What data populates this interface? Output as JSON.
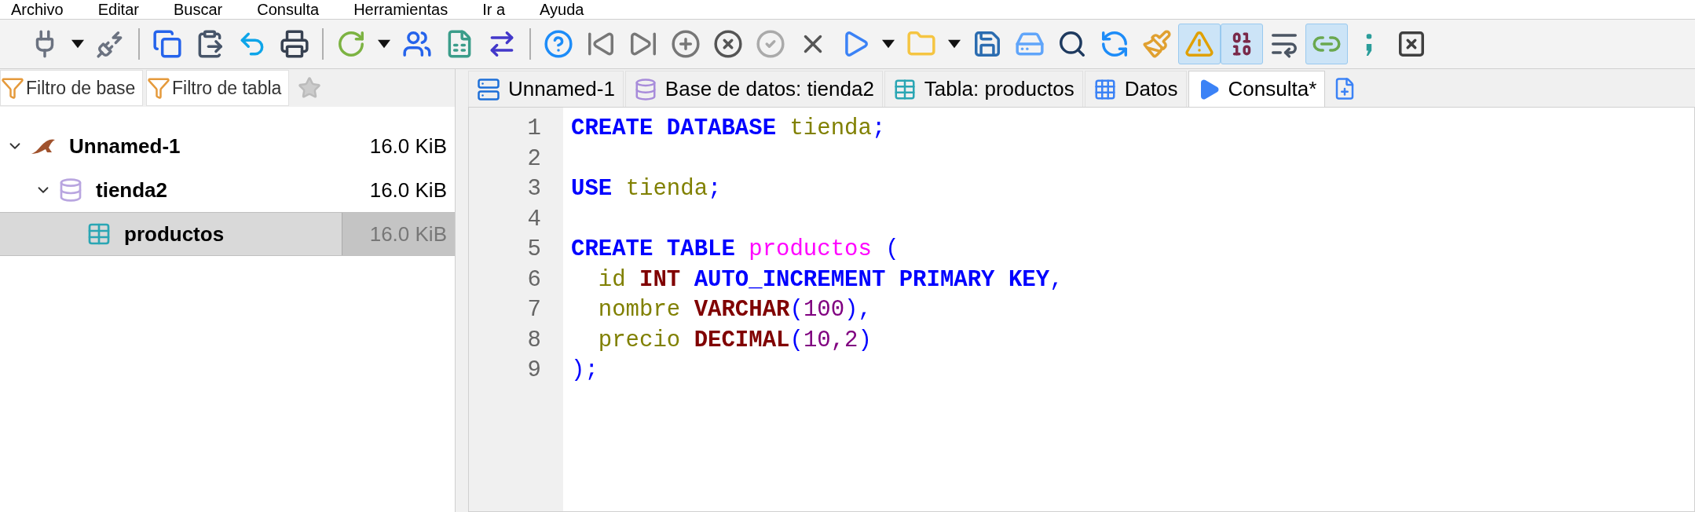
{
  "menu": [
    "Archivo",
    "Editar",
    "Buscar",
    "Consulta",
    "Herramientas",
    "Ir a",
    "Ayuda"
  ],
  "toolbar": {
    "buttons": [
      {
        "on": false
      },
      {
        "on": false
      },
      {
        "on": false
      },
      {
        "on": false
      },
      {
        "on": false
      },
      {
        "on": false
      },
      {
        "on": false
      },
      {
        "on": false
      },
      {
        "on": false
      },
      {
        "on": false
      },
      {
        "on": false
      },
      {
        "on": false
      },
      {
        "on": false
      },
      {
        "on": false
      },
      {
        "on": false
      },
      {
        "on": false
      },
      {
        "on": false
      },
      {
        "on": false
      },
      {
        "on": false
      },
      {
        "on": false
      },
      {
        "on": false
      },
      {
        "on": false
      },
      {
        "on": false
      },
      {
        "on": false
      },
      {
        "on": false
      },
      {
        "on": false
      },
      {
        "on": false
      },
      {
        "on": false
      },
      {
        "on": true
      },
      {
        "on": true
      },
      {
        "on": false
      },
      {
        "on": true
      },
      {
        "on": false
      },
      {
        "on": false
      }
    ]
  },
  "filters": [
    {
      "placeholder": "Filtro de base"
    },
    {
      "placeholder": "Filtro de tabla"
    }
  ],
  "tree": [
    {
      "label": "Unnamed-1",
      "size": "16.0 KiB",
      "expanded": true,
      "selected": false,
      "children": [
        {
          "label": "tienda2",
          "size": "16.0 KiB",
          "expanded": true,
          "selected": false,
          "children": [
            {
              "label": "productos",
              "size": "16.0 KiB",
              "selected": true
            }
          ]
        }
      ]
    }
  ],
  "tabs": [
    {
      "label": "Unnamed-1",
      "selected": false
    },
    {
      "label": "Base de datos: tienda2",
      "selected": false
    },
    {
      "label": "Tabla: productos",
      "selected": false
    },
    {
      "label": "Datos",
      "selected": false
    },
    {
      "label": "Consulta*",
      "selected": true
    }
  ],
  "editor": {
    "lines": [
      {
        "number": "1",
        "tokens": [
          {
            "kind": "keyword",
            "text": "CREATE DATABASE "
          },
          {
            "kind": "ident",
            "text": "tienda"
          },
          {
            "kind": "punct",
            "text": ";"
          }
        ]
      },
      {
        "number": "2"
      },
      {
        "number": "3",
        "tokens": [
          {
            "kind": "keyword",
            "text": "USE "
          },
          {
            "kind": "ident",
            "text": "tienda"
          },
          {
            "kind": "punct",
            "text": ";"
          }
        ]
      },
      {
        "number": "4"
      },
      {
        "number": "5",
        "tokens": [
          {
            "kind": "keyword",
            "text": "CREATE TABLE "
          },
          {
            "kind": "table",
            "text": "productos"
          },
          {
            "kind": "punct",
            "text": " ("
          }
        ]
      },
      {
        "number": "6",
        "tokens": [
          {
            "kind": "ident",
            "text": "  id "
          },
          {
            "kind": "type",
            "text": "INT "
          },
          {
            "kind": "keyword",
            "text": "AUTO_INCREMENT PRIMARY KEY"
          },
          {
            "kind": "punct",
            "text": ","
          }
        ]
      },
      {
        "number": "7",
        "tokens": [
          {
            "kind": "ident",
            "text": "  nombre "
          },
          {
            "kind": "type",
            "text": "VARCHAR"
          },
          {
            "kind": "punct",
            "text": "("
          },
          {
            "kind": "number",
            "text": "100"
          },
          {
            "kind": "punct",
            "text": "),"
          }
        ]
      },
      {
        "number": "8",
        "tokens": [
          {
            "kind": "ident",
            "text": "  precio "
          },
          {
            "kind": "type",
            "text": "DECIMAL"
          },
          {
            "kind": "punct",
            "text": "("
          },
          {
            "kind": "number",
            "text": "10,2"
          },
          {
            "kind": "punct",
            "text": ")"
          }
        ]
      },
      {
        "number": "9",
        "tokens": [
          {
            "kind": "punct",
            "text": ");"
          }
        ]
      }
    ]
  }
}
